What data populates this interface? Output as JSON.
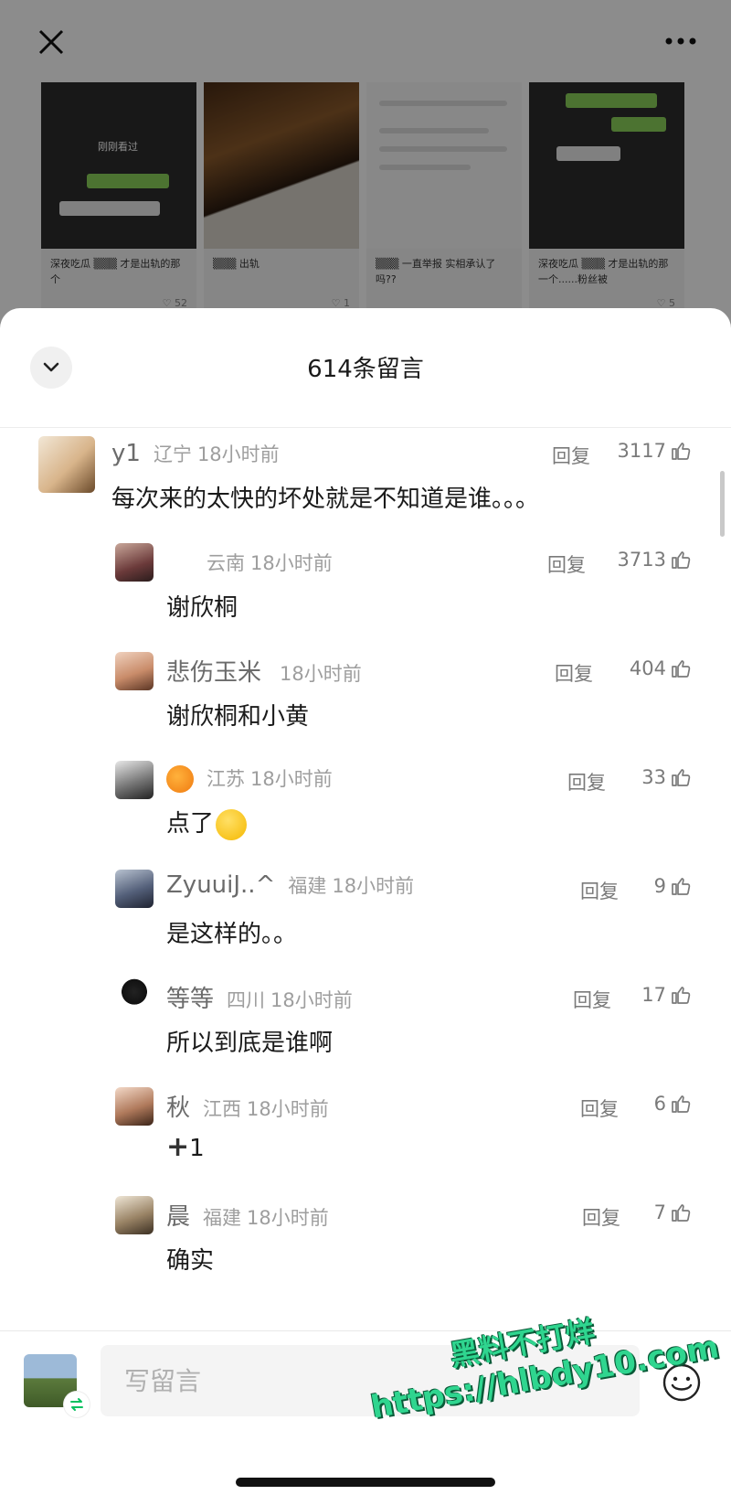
{
  "background": {
    "cards": [
      {
        "title": "深夜吃瓜 ▒▒▒ 才是出轨的那个",
        "count": "♡ 52",
        "overlay": "刚刚看过"
      },
      {
        "title": "▒▒▒ 出轨",
        "count": "♡ 1",
        "overlay": ""
      },
      {
        "title": "▒▒▒ 一直举报 实相承认了吗??",
        "count": "",
        "overlay": ""
      },
      {
        "title": "深夜吃瓜 ▒▒▒ 才是出轨的那一个......粉丝被",
        "count": "♡ 5",
        "overlay": ""
      }
    ]
  },
  "sheet": {
    "title": "614条留言"
  },
  "comments": [
    {
      "name": "y1",
      "location": "辽宁",
      "time": "18小时前",
      "reply": "回复",
      "likes": "3117",
      "text": "每次来的太快的坏处就是不知道是谁。。。"
    },
    {
      "name": "",
      "location": "云南",
      "time": "18小时前",
      "reply": "回复",
      "likes": "3713",
      "text": "谢欣桐"
    },
    {
      "name": "悲伤玉米",
      "location": "",
      "time": "18小时前",
      "reply": "回复",
      "likes": "404",
      "text": "谢欣桐和小黄"
    },
    {
      "name": "",
      "location": "江苏",
      "time": "18小时前",
      "reply": "回复",
      "likes": "33",
      "text": "点了"
    },
    {
      "name": "ZyuuiJ..^",
      "location": "福建",
      "time": "18小时前",
      "reply": "回复",
      "likes": "9",
      "text": "是这样的。。"
    },
    {
      "name": "等等",
      "location": "四川",
      "time": "18小时前",
      "reply": "回复",
      "likes": "17",
      "text": "所以到底是谁啊"
    },
    {
      "name": "秋",
      "location": "江西",
      "time": "18小时前",
      "reply": "回复",
      "likes": "6",
      "text": "1"
    },
    {
      "name": "晨",
      "location": "福建",
      "time": "18小时前",
      "reply": "回复",
      "likes": "7",
      "text": "确实"
    }
  ],
  "input": {
    "placeholder": "写留言"
  },
  "watermark": {
    "line1": "黑料不打烊",
    "line2": "https://hlbdy10.com"
  },
  "colors": {
    "accent": "#07c160",
    "watermark": "#2fd58f"
  },
  "icons": [
    "close-icon",
    "more-icon",
    "chevron-down-icon",
    "thumbs-up-icon",
    "pumpkin-emoji-icon",
    "laughing-emoji-icon",
    "plus-icon",
    "switch-account-icon",
    "emoji-icon"
  ]
}
